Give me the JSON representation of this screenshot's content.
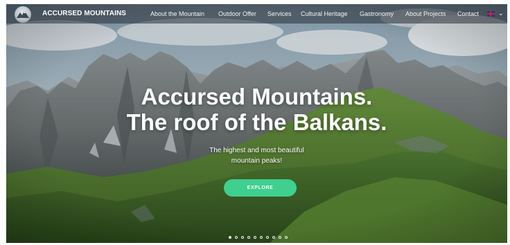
{
  "brand": {
    "name": "ACCURSED MOUNTAINS",
    "logo_icon": "mountain-logo-icon"
  },
  "nav": {
    "items": [
      {
        "label": "About the Mountain"
      },
      {
        "label": "Outdoor Offer"
      },
      {
        "label": "Services"
      },
      {
        "label": "Cultural Heritage"
      },
      {
        "label": "Gastronomy"
      },
      {
        "label": "About Projects"
      },
      {
        "label": "Contact"
      }
    ],
    "language_icon": "uk-flag-icon",
    "dropdown_icon": "chevron-down-icon"
  },
  "hero": {
    "title_line1": "Accursed Mountains.",
    "title_line2": "The roof of the Balkans.",
    "subtitle_line1": "The highest and most beautiful",
    "subtitle_line2": "mountain peaks!",
    "cta_label": "EXPLORE"
  },
  "slider": {
    "slide_count": 10,
    "active_index": 0
  },
  "colors": {
    "accent": "#3fcf8e",
    "nav_background": "#283038",
    "text": "#ffffff"
  }
}
